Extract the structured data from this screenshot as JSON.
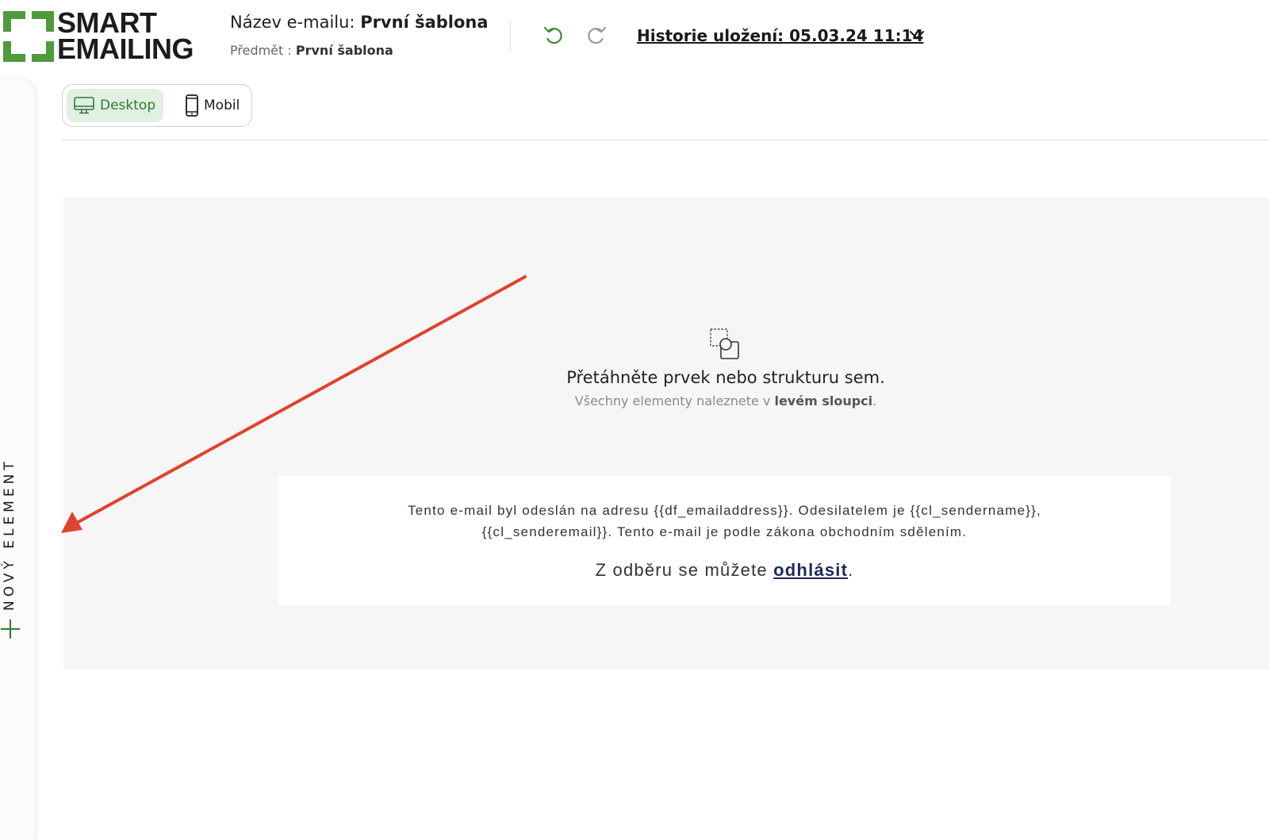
{
  "logo": {
    "line1": "SMART",
    "line2": "EMAILING",
    "brand_color": "#4e9a3c"
  },
  "header": {
    "name_label": "Název e-mailu:",
    "name_value": "První šablona",
    "subject_label": "Předmět :",
    "subject_value": "První šablona",
    "undo_icon": "undo-icon",
    "redo_icon": "redo-icon",
    "history_label": "Historie uložení: 05.03.24 11:14"
  },
  "sidebar": {
    "new_element_label": "NOVÝ ELEMENT"
  },
  "device_toggle": {
    "desktop_label": "Desktop",
    "mobile_label": "Mobil",
    "active": "Desktop",
    "active_color": "#2f7a31",
    "active_bg": "#e2efe3"
  },
  "canvas": {
    "drop_title": "Přetáhněte prvek nebo strukturu sem.",
    "drop_sub_prefix": "Všechny elementy naleznete v",
    "drop_sub_bold": "levém sloupci",
    "drop_sub_suffix": ".",
    "footer_line1": "Tento e-mail byl odeslán na adresu {{df_emailaddress}}. Odesilatelem je {{cl_sendername}},",
    "footer_line2": "{{cl_senderemail}}. Tento e-mail je podle zákona obchodním sdělením.",
    "unsub_prefix": "Z odběru se můžete",
    "unsub_link": "odhlásit",
    "unsub_suffix": "."
  },
  "annotation": {
    "arrow_color": "#e0432b"
  }
}
